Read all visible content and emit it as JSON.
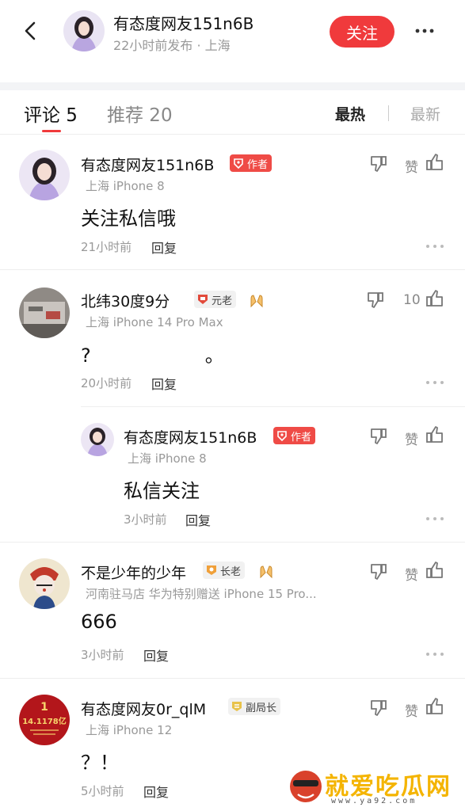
{
  "header": {
    "author_name": "有态度网友151n6B",
    "subtitle": "22小时前发布 · 上海",
    "follow_label": "关注"
  },
  "tabs": {
    "comments_label": "评论 5",
    "recommend_label": "推荐 20",
    "sort_hot": "最热",
    "sort_new": "最新"
  },
  "comments": [
    {
      "name": "有态度网友151n6B",
      "badge": "作者",
      "location": "上海 iPhone 8",
      "text": "关注私信哦",
      "time": "21小时前",
      "reply": "回复",
      "like": "赞"
    },
    {
      "name": "北纬30度9分",
      "badge": "元老",
      "location": "上海 iPhone 14 Pro Max",
      "text": "?　　　　　　。",
      "time": "20小时前",
      "reply": "回复",
      "like": "10"
    },
    {
      "name": "有态度网友151n6B",
      "badge": "作者",
      "location": "上海 iPhone 8",
      "text": "私信关注",
      "time": "3小时前",
      "reply": "回复",
      "like": "赞"
    },
    {
      "name": "不是少年的少年",
      "badge": "长老",
      "location": "河南驻马店 华为特别赠送 iPhone 15 Pro...",
      "text": "666",
      "time": "3小时前",
      "reply": "回复",
      "like": "赞"
    },
    {
      "name": "有态度网友0r_qlM",
      "badge": "副局长",
      "location": "上海 iPhone 12",
      "text": "？！",
      "time": "5小时前",
      "reply": "回复",
      "like": "赞",
      "avatar_text_top": "1",
      "avatar_text_bottom": "14.1178亿"
    }
  ],
  "watermark": {
    "text": "就爱吃瓜网",
    "url": "www.ya92.com"
  },
  "colors": {
    "accent_red": "#f03a3c",
    "author_badge": "#ef4b46",
    "muted": "#999999",
    "watermark": "#f4b400"
  }
}
